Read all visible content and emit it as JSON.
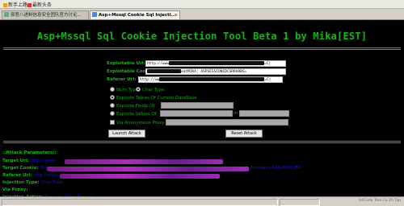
{
  "bookmarks": [
    {
      "label": "新手上路"
    },
    {
      "label": "最新头条"
    }
  ],
  "tabs": [
    {
      "label": "邪恶八进制信息安全团队官方讨论..."
    },
    {
      "label": "Asp+Mssql Cookie Sql Injecti..."
    }
  ],
  "page": {
    "title": "Asp+Mssql Sql Cookie Injection Tool Beta 1 by Mika[EST]"
  },
  "form": {
    "exploitable_url": {
      "label": "Exploitable Url:",
      "value_prefix": "http://www",
      "value_suffix": "=C|"
    },
    "exploitable_cookie": {
      "label": "Exploitable Cookie:",
      "value_mid": "eatMIKA; ASPSESSIONIDCSRRARBS="
    },
    "referer_url": {
      "label": "Referer Url:",
      "value_prefix": "http://ww",
      "value_suffix": "=C|"
    },
    "types": [
      {
        "label": "Num Type",
        "selected": false
      },
      {
        "label": "Char Type",
        "selected": true
      }
    ],
    "explode_tables": {
      "label": "Explode Tables Of Current DataBase",
      "selected": true
    },
    "explode_fields": {
      "label": "Explode Fields Of",
      "selected": false
    },
    "explode_values": {
      "label": "Explode Values Of",
      "selected": false,
      "in_label": "In"
    },
    "anonymous_proxy": {
      "label": "Via Anonymous Proxy",
      "checked": false
    },
    "launch_button": "Launch Attack",
    "reset_button": "Reset Attack"
  },
  "output": {
    "header": "::Attack Parameters::",
    "target_url": {
      "key": "Target Url:",
      "value": "http://www"
    },
    "target_cookie": {
      "key": "Target Cookie:",
      "value_start": "Mika",
      "value_end": "Monday=Ad6XMNCIEA"
    },
    "referer_url": {
      "key": "Referer Url:",
      "value": "http://www"
    },
    "injection_type": {
      "key": "Injection Type:",
      "value": "Char Type"
    },
    "via_proxy": {
      "key": "Via Proxy:",
      "value": ""
    },
    "injection_action": {
      "key": "Injection Action:",
      "value": "Explode Table Name!"
    }
  },
  "status": {
    "watermark": "IntCode Tree Ca Zh Tap"
  },
  "colors": {
    "accent_green": "#15b615",
    "value_blue": "#1414c8",
    "redaction_purple": "#b431c4"
  }
}
